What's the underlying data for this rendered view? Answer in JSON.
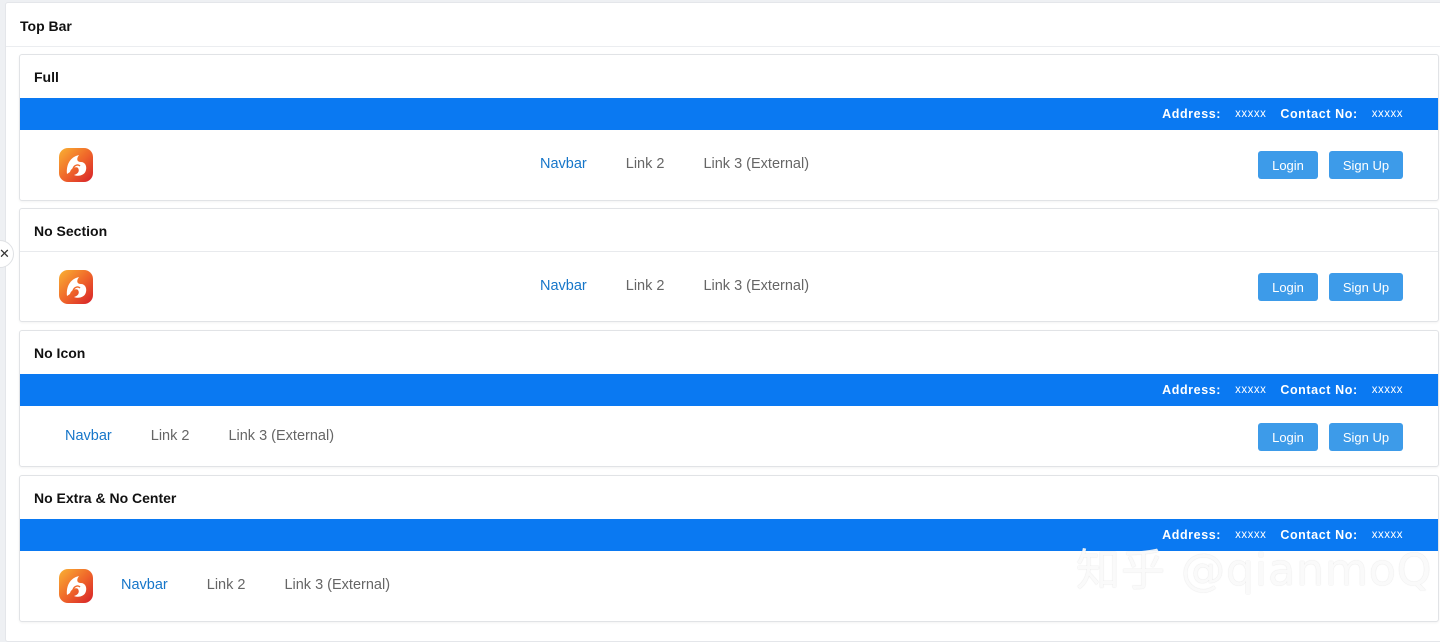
{
  "page": {
    "title": "Top Bar"
  },
  "info": {
    "address_label": "Address:",
    "address_value": "xxxxx",
    "contact_label": "Contact No:",
    "contact_value": "xxxxx"
  },
  "nav": {
    "links": [
      "Navbar",
      "Link 2",
      "Link 3 (External)"
    ],
    "login": "Login",
    "signup": "Sign Up"
  },
  "sections": [
    {
      "title": "Full"
    },
    {
      "title": "No Section"
    },
    {
      "title": "No Icon"
    },
    {
      "title": "No Extra & No Center"
    }
  ],
  "colors": {
    "info_bar": "#0a79f2",
    "button": "#3d9be9",
    "active_link": "#1676c9"
  },
  "icons": {
    "logo": "fox-logo-icon",
    "side_handle": "close-icon"
  },
  "watermark": "知乎 @qianmoQ"
}
